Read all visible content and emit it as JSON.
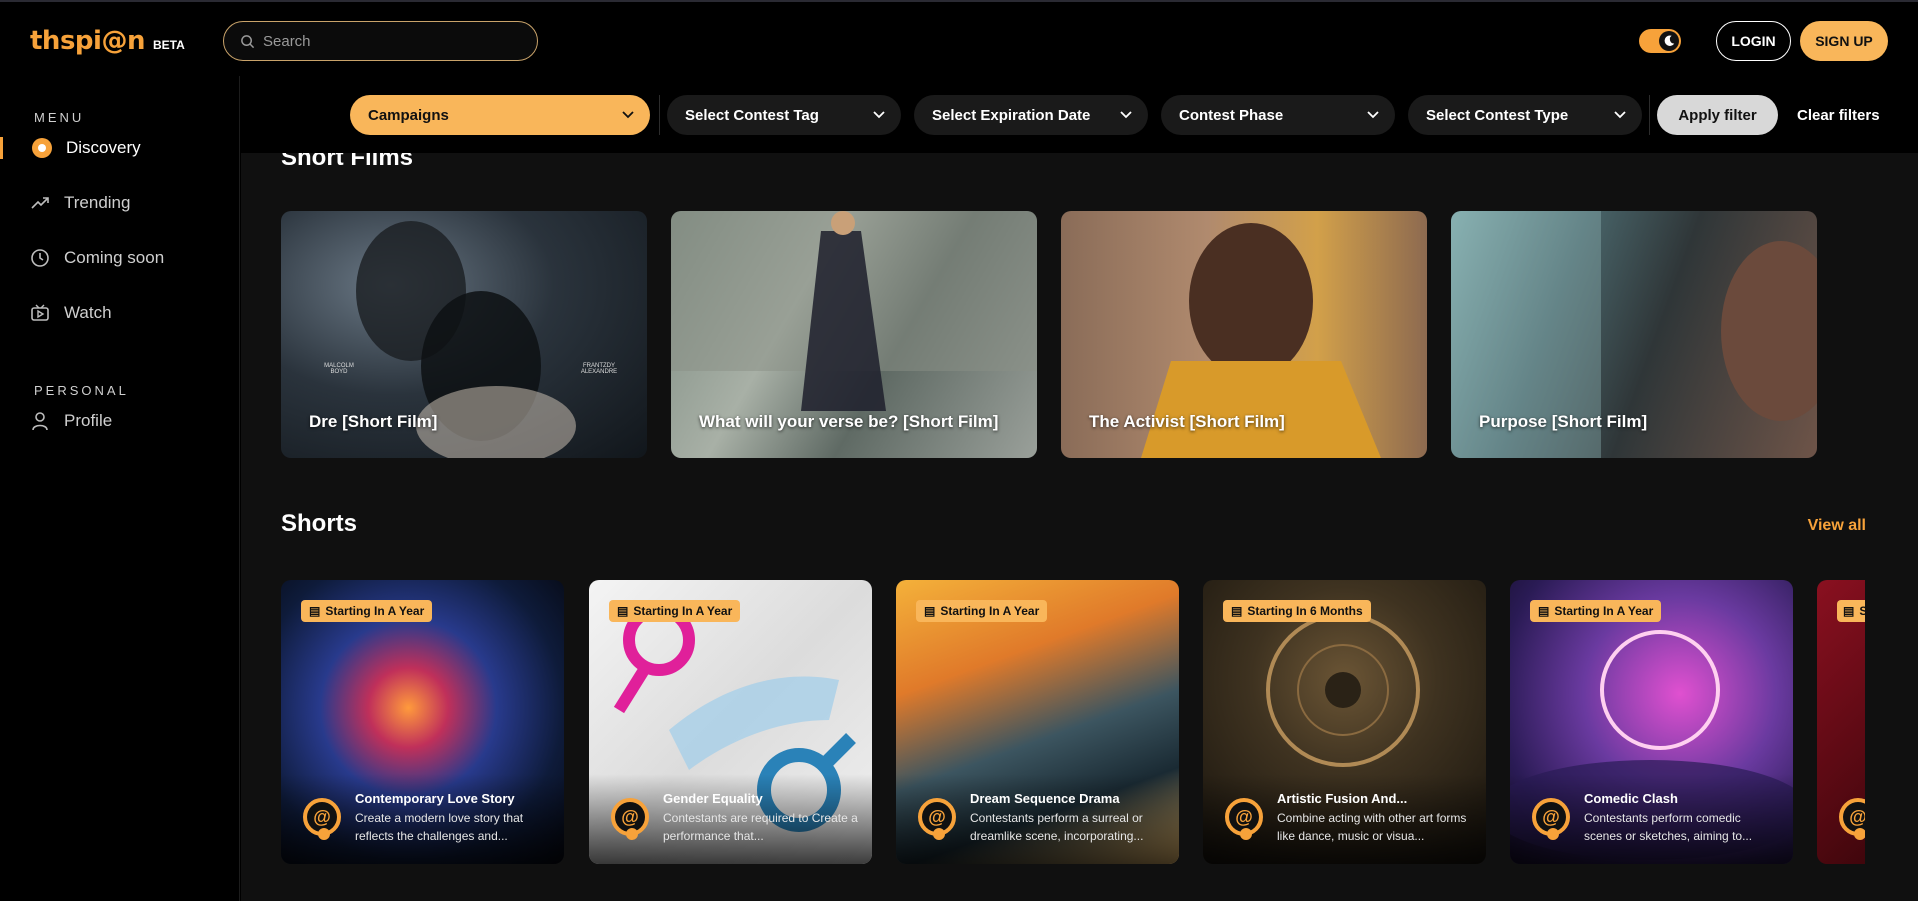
{
  "header": {
    "logo": "thspi@n",
    "beta": "BETA",
    "search_placeholder": "Search",
    "login": "LOGIN",
    "signup": "SIGN UP"
  },
  "sidebar": {
    "menu_label": "MENU",
    "personal_label": "PERSONAL",
    "items": [
      {
        "label": "Discovery",
        "icon": "discovery-icon"
      },
      {
        "label": "Trending",
        "icon": "trending-icon"
      },
      {
        "label": "Coming soon",
        "icon": "clock-icon"
      },
      {
        "label": "Watch",
        "icon": "watch-icon"
      }
    ],
    "personal_items": [
      {
        "label": "Profile",
        "icon": "user-icon"
      }
    ]
  },
  "filters": {
    "items": [
      "Campaigns",
      "Select Contest Tag",
      "Select Expiration Date",
      "Contest Phase",
      "Select Contest Type"
    ],
    "apply": "Apply filter",
    "clear": "Clear filters"
  },
  "short_films": {
    "title": "Short Films",
    "items": [
      {
        "title": "Dre [Short Film]",
        "poster_left": "MALCOLM BOYD",
        "poster_right": "FRANTZDY ALEXANDRE"
      },
      {
        "title": "What will your verse be? [Short Film]"
      },
      {
        "title": "The Activist [Short Film]"
      },
      {
        "title": "Purpose [Short Film]"
      }
    ]
  },
  "shorts": {
    "title": "Shorts",
    "view_all": "View all",
    "items": [
      {
        "badge": "Starting In A Year",
        "title": "Contemporary Love Story",
        "desc": "Create a modern love story that reflects the challenges and..."
      },
      {
        "badge": "Starting In A Year",
        "title": "Gender Equality",
        "desc": "Contestants are required to Create a performance that..."
      },
      {
        "badge": "Starting In A Year",
        "title": "Dream Sequence Drama",
        "desc": "Contestants perform a surreal or dreamlike scene, incorporating..."
      },
      {
        "badge": "Starting In 6 Months",
        "title": "Artistic Fusion And...",
        "desc": "Combine acting with other art forms like dance, music or visua..."
      },
      {
        "badge": "Starting In A Year",
        "title": "Comedic Clash",
        "desc": "Contestants perform comedic scenes or sketches, aiming to..."
      },
      {
        "badge": "S",
        "title": "",
        "desc": ""
      }
    ]
  },
  "colors": {
    "accent": "#f7a23a",
    "accent_light": "#f9b65a",
    "background": "#000000",
    "panel": "#101010"
  }
}
